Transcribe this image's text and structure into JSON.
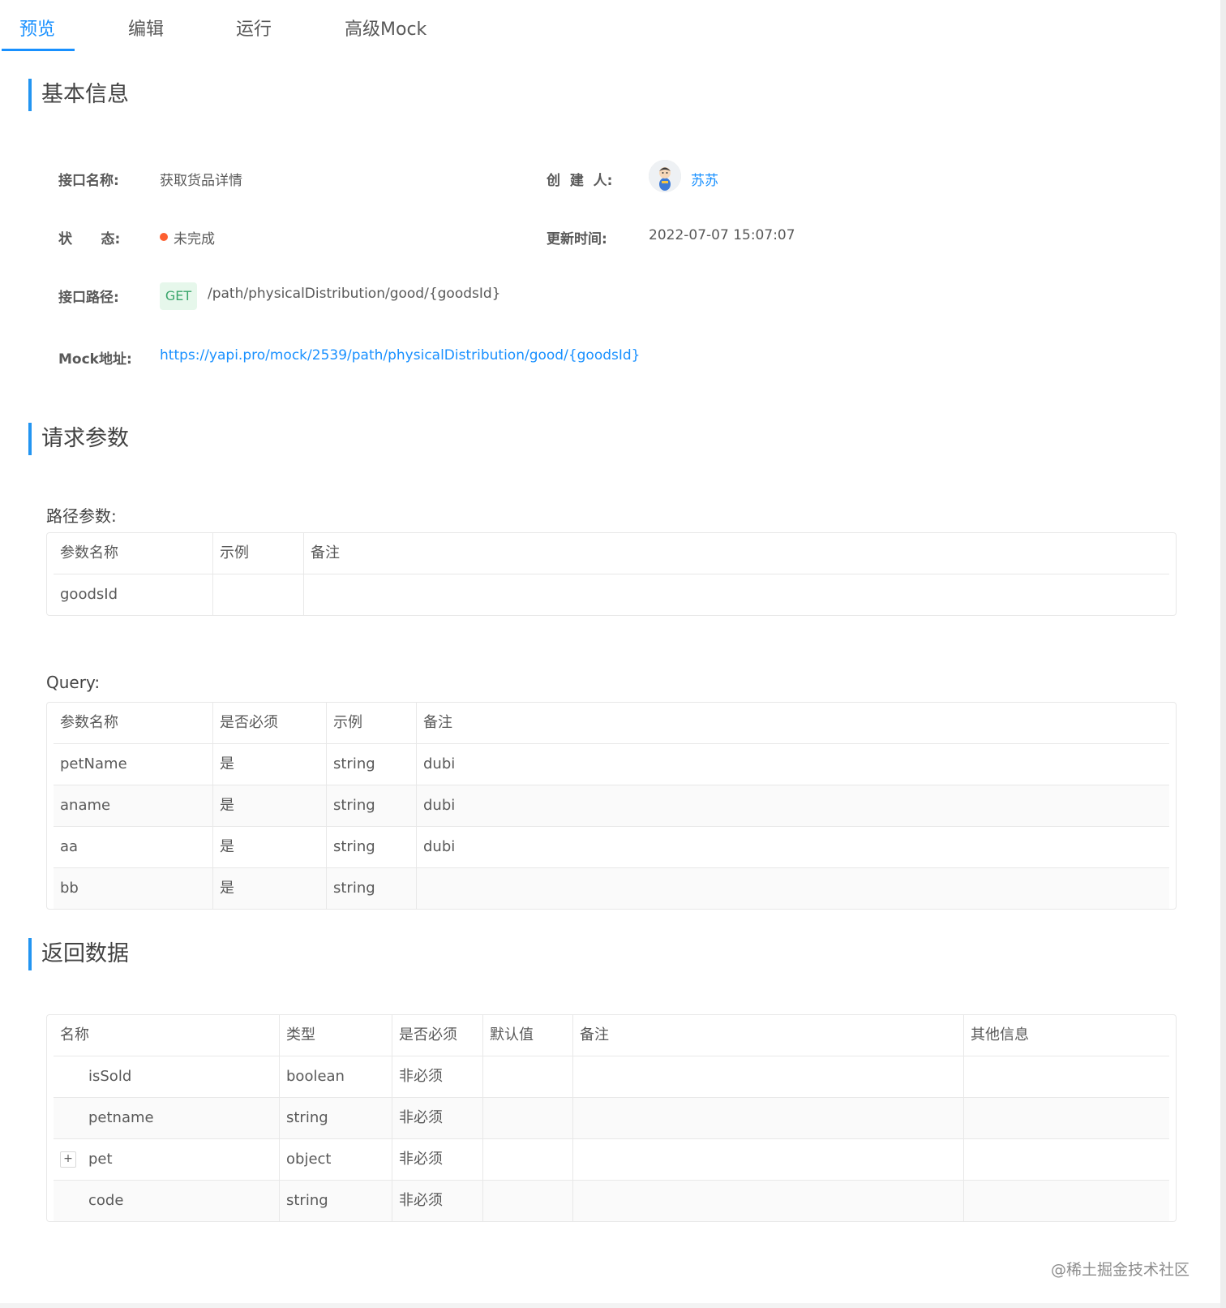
{
  "tabs": [
    {
      "label": "预览",
      "active": true
    },
    {
      "label": "编辑",
      "active": false
    },
    {
      "label": "运行",
      "active": false
    },
    {
      "label": "高级Mock",
      "active": false
    }
  ],
  "sections": {
    "basic_info": "基本信息",
    "request_params": "请求参数",
    "response_data": "返回数据"
  },
  "basic_info": {
    "name_label": "接口名称:",
    "name_value": "获取货品详情",
    "creator_label": "创  建  人:",
    "creator_value": "苏苏",
    "status_label": "状      态:",
    "status_value": "未完成",
    "status_color": "#fd5f30",
    "updated_label": "更新时间:",
    "updated_value": "2022-07-07 15:07:07",
    "path_label": "接口路径:",
    "method": "GET",
    "path_value": "/path/physicalDistribution/good/{goodsId}",
    "mock_label": "Mock地址:",
    "mock_value": "https://yapi.pro/mock/2539/path/physicalDistribution/good/{goodsId}"
  },
  "path_params": {
    "title": "路径参数:",
    "headers": [
      "参数名称",
      "示例",
      "备注"
    ],
    "rows": [
      [
        "goodsId",
        "",
        ""
      ]
    ]
  },
  "query_params": {
    "title": "Query:",
    "headers": [
      "参数名称",
      "是否必须",
      "示例",
      "备注"
    ],
    "rows": [
      [
        "petName",
        "是",
        "string",
        "dubi"
      ],
      [
        "aname",
        "是",
        "string",
        "dubi"
      ],
      [
        "aa",
        "是",
        "string",
        "dubi"
      ],
      [
        "bb",
        "是",
        "string",
        ""
      ]
    ]
  },
  "response": {
    "headers": [
      "名称",
      "类型",
      "是否必须",
      "默认值",
      "备注",
      "其他信息"
    ],
    "rows": [
      [
        "isSold",
        "boolean",
        "非必须",
        "",
        "",
        ""
      ],
      [
        "petname",
        "string",
        "非必须",
        "",
        "",
        ""
      ],
      [
        "pet",
        "object",
        "非必须",
        "",
        "",
        ""
      ],
      [
        "code",
        "string",
        "非必须",
        "",
        "",
        ""
      ]
    ],
    "expand_symbol": "+"
  },
  "colors": {
    "accent": "#1890ff",
    "section_bar": "#2395f1",
    "get_tag_bg": "#e6f7eb",
    "get_tag_text": "#3aa56b"
  },
  "watermark": "@稀土掘金技术社区"
}
